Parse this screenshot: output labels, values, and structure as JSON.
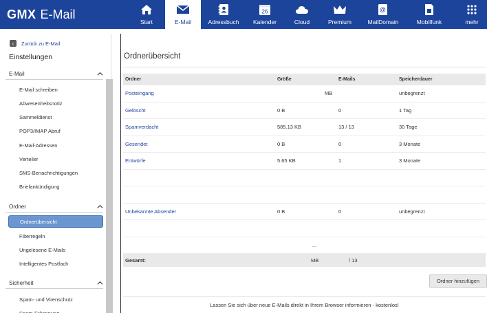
{
  "header": {
    "logo_brand": "GMX",
    "logo_product": "E-Mail",
    "nav": [
      {
        "label": "Start",
        "icon": "home-icon"
      },
      {
        "label": "E-Mail",
        "icon": "envelope-icon"
      },
      {
        "label": "Adressbuch",
        "icon": "addressbook-icon"
      },
      {
        "label": "Kalender",
        "icon": "calendar-icon",
        "badge": "26"
      },
      {
        "label": "Cloud",
        "icon": "cloud-icon"
      },
      {
        "label": "Premium",
        "icon": "crown-icon"
      },
      {
        "label": "MailDomain",
        "icon": "maildomain-icon"
      },
      {
        "label": "Mobilfunk",
        "icon": "sim-icon"
      },
      {
        "label": "mehr",
        "icon": "grid-icon"
      }
    ],
    "active_nav": "E-Mail"
  },
  "sidebar": {
    "back_label": "Zurück zu E-Mail",
    "title": "Einstellungen",
    "sections": [
      {
        "label": "E-Mail",
        "items": [
          "E-Mail schreiben",
          "Abwesenheitsnotiz",
          "Sammeldienst",
          "POP3/IMAP Abruf",
          "E-Mail-Adressen",
          "Verteiler",
          "SMS-Benachrichtigungen",
          "Briefankündigung"
        ]
      },
      {
        "label": "Ordner",
        "items": [
          "Ordnerübersicht",
          "Filterregeln",
          "Ungelesene E-Mails",
          "Intelligentes Postfach"
        ]
      },
      {
        "label": "Sicherheit",
        "items": [
          "Spam- und Virenschutz",
          "Spam-Erkennung"
        ]
      }
    ],
    "active_item": "Ordnerübersicht"
  },
  "main": {
    "title": "Ordnerübersicht",
    "columns": [
      "Ordner",
      "Größe",
      "E-Mails",
      "Speicherdauer"
    ],
    "rows": [
      {
        "name": "Posteingang",
        "size": "MB",
        "mails": "",
        "duration": "unbegrenzt"
      },
      {
        "name": "Gelöscht",
        "size": "0 B",
        "mails": "0",
        "duration": "1 Tag"
      },
      {
        "name": "Spamverdacht",
        "size": "585.13 KB",
        "mails": "13 / 13",
        "duration": "30 Tage"
      },
      {
        "name": "Gesendet",
        "size": "0 B",
        "mails": "0",
        "duration": "3 Monate"
      },
      {
        "name": "Entwürfe",
        "size": "5.65 KB",
        "mails": "1",
        "duration": "3 Monate"
      },
      {
        "name": "",
        "size": "",
        "mails": "",
        "duration": ""
      },
      {
        "name": "",
        "size": "",
        "mails": "",
        "duration": ""
      },
      {
        "name": "Unbekannte Absender",
        "size": "0 B",
        "mails": "0",
        "duration": "unbegrenzt"
      },
      {
        "name": "",
        "size": "",
        "mails": "",
        "duration": ""
      },
      {
        "name": "",
        "size": "...",
        "mails": "",
        "duration": ""
      }
    ],
    "total": {
      "label": "Gesamt:",
      "size": "MB",
      "mails": "/ 13"
    },
    "add_button": "Ordner hinzufügen",
    "notice": "Lassen Sie sich über neue E-Mails direkt in Ihrem Browser informieren - kostenlos!"
  },
  "colors": {
    "brand": "#1c449b",
    "active_item": "#6b96cf"
  }
}
